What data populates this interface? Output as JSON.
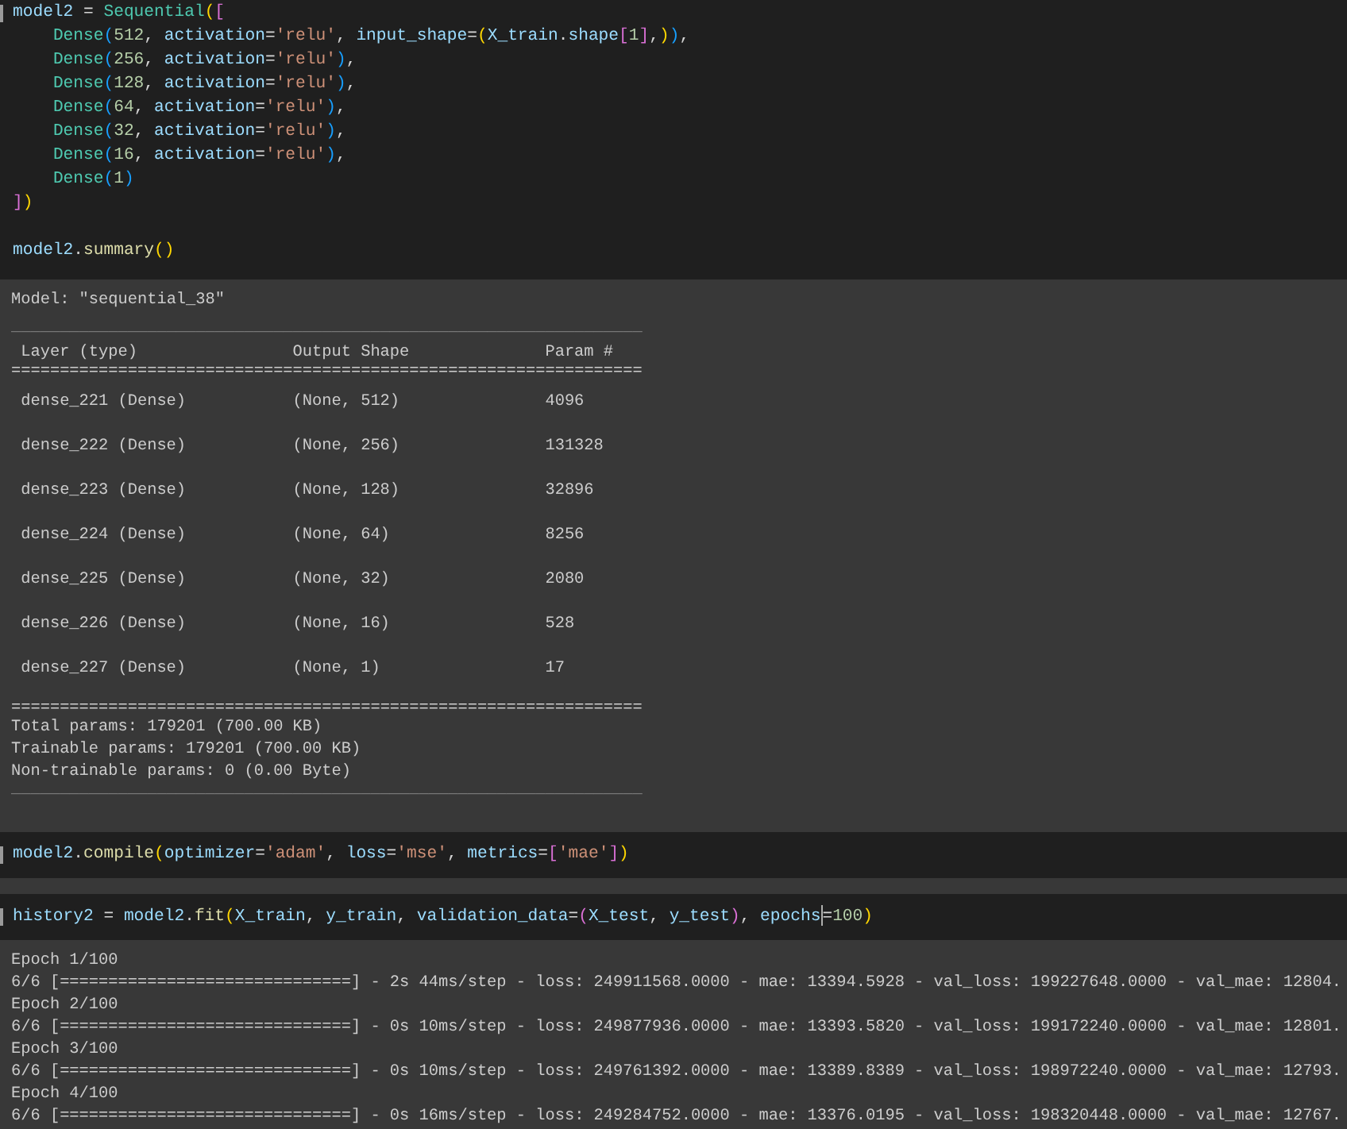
{
  "cells": [
    {
      "kind": "code",
      "blocks": [
        [
          "model2 = Sequential([",
          "    Dense(512, activation='relu', input_shape=(X_train.shape[1],)),",
          "    Dense(256, activation='relu'),",
          "    Dense(128, activation='relu'),",
          "    Dense(64, activation='relu'),",
          "    Dense(32, activation='relu'),",
          "    Dense(16, activation='relu'),",
          "    Dense(1)",
          "])"
        ],
        [
          "model2.summary()"
        ]
      ],
      "output": {
        "kind": "summary",
        "title": "Model: \"sequential_38\"",
        "rule": "_________________________________________________________________",
        "double_rule": "=================================================================",
        "columns": [
          "Layer (type)",
          "Output Shape",
          "Param #"
        ],
        "rows": [
          [
            "dense_221 (Dense)",
            "(None, 512)",
            "4096"
          ],
          [
            "dense_222 (Dense)",
            "(None, 256)",
            "131328"
          ],
          [
            "dense_223 (Dense)",
            "(None, 128)",
            "32896"
          ],
          [
            "dense_224 (Dense)",
            "(None, 64)",
            "8256"
          ],
          [
            "dense_225 (Dense)",
            "(None, 32)",
            "2080"
          ],
          [
            "dense_226 (Dense)",
            "(None, 16)",
            "528"
          ],
          [
            "dense_227 (Dense)",
            "(None, 1)",
            "17"
          ]
        ],
        "totals": [
          "Total params: 179201 (700.00 KB)",
          "Trainable params: 179201 (700.00 KB)",
          "Non-trainable params: 0 (0.00 Byte)"
        ]
      }
    },
    {
      "kind": "code",
      "blocks": [
        [
          "model2.compile(optimizer='adam', loss='mse', metrics=['mae'])"
        ]
      ]
    },
    {
      "kind": "code",
      "blocks": [
        [
          {
            "before_cursor": "history2 = model2.fit(X_train, y_train, validation_data=(X_test, y_test), epochs",
            "after_cursor": "=100)"
          }
        ]
      ],
      "output": {
        "kind": "log",
        "lines": [
          "Epoch 1/100",
          "6/6 [==============================] - 2s 44ms/step - loss: 249911568.0000 - mae: 13394.5928 - val_loss: 199227648.0000 - val_mae: 12804.",
          "Epoch 2/100",
          "6/6 [==============================] - 0s 10ms/step - loss: 249877936.0000 - mae: 13393.5820 - val_loss: 199172240.0000 - val_mae: 12801.",
          "Epoch 3/100",
          "6/6 [==============================] - 0s 10ms/step - loss: 249761392.0000 - mae: 13389.8389 - val_loss: 198972240.0000 - val_mae: 12793.",
          "Epoch 4/100",
          "6/6 [==============================] - 0s 16ms/step - loss: 249284752.0000 - mae: 13376.0195 - val_loss: 198320448.0000 - val_mae: 12767."
        ]
      }
    }
  ]
}
